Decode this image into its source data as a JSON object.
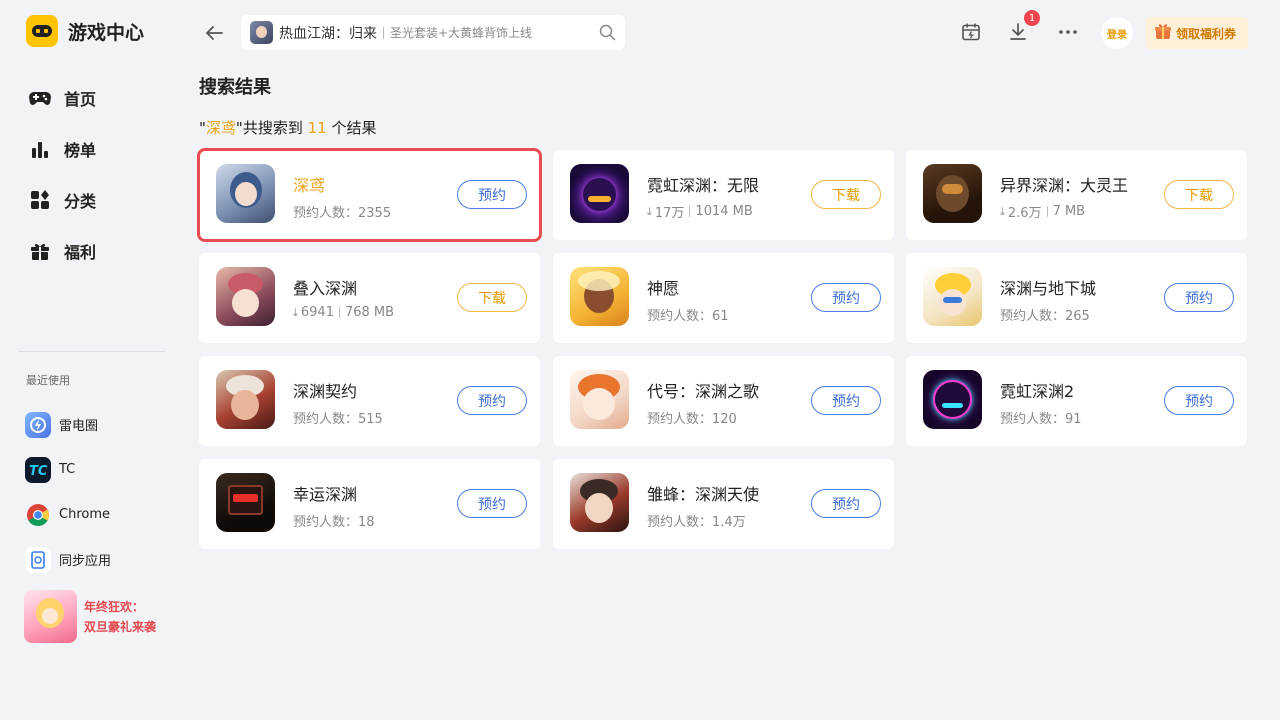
{
  "app": {
    "title": "游戏中心"
  },
  "sidebar": {
    "nav": [
      {
        "label": "首页",
        "icon": "gamepad-icon"
      },
      {
        "label": "榜单",
        "icon": "ranking-icon"
      },
      {
        "label": "分类",
        "icon": "category-icon"
      },
      {
        "label": "福利",
        "icon": "gift-icon"
      }
    ],
    "recent_title": "最近使用",
    "recent": [
      {
        "label": "雷电圈",
        "icon": "leidian-icon"
      },
      {
        "label": "TC",
        "icon": "tc-icon"
      },
      {
        "label": "Chrome",
        "icon": "chrome-icon"
      },
      {
        "label": "同步应用",
        "icon": "sync-app-icon"
      }
    ],
    "promo": {
      "line1": "年终狂欢：",
      "line2": "双旦豪礼来袭"
    }
  },
  "topbar": {
    "search_main": "热血江湖：归来",
    "search_sub": "圣光套装+大黄蜂背饰上线",
    "download_badge": "1",
    "login_label": "登录",
    "coupon_label": "领取福利券"
  },
  "content": {
    "title": "搜索结果",
    "summary": {
      "quote_open": "\"",
      "keyword": "深鸢",
      "text1": "\"共搜索到 ",
      "count": "11",
      "text2": " 个结果"
    }
  },
  "results": [
    {
      "name": "深鸢",
      "meta": "预约人数：2355",
      "button": "预约"
    },
    {
      "name": "霓虹深渊：无限",
      "downloads": "17万",
      "size": "1014 MB",
      "button": "下载"
    },
    {
      "name": "异界深渊：大灵王",
      "downloads": "2.6万",
      "size": "7 MB",
      "button": "下载"
    },
    {
      "name": "叠入深渊",
      "downloads": "6941",
      "size": "768 MB",
      "button": "下载"
    },
    {
      "name": "神愿",
      "meta": "预约人数：61",
      "button": "预约"
    },
    {
      "name": "深渊与地下城",
      "meta": "预约人数：265",
      "button": "预约"
    },
    {
      "name": "深渊契约",
      "meta": "预约人数：515",
      "button": "预约"
    },
    {
      "name": "代号：深渊之歌",
      "meta": "预约人数：120",
      "button": "预约"
    },
    {
      "name": "霓虹深渊2",
      "meta": "预约人数：91",
      "button": "预约"
    },
    {
      "name": "幸运深渊",
      "meta": "预约人数：18",
      "button": "预约"
    },
    {
      "name": "雏蜂：深渊天使",
      "meta": "预约人数：1.4万",
      "button": "预约"
    }
  ],
  "colors": {
    "accent": "#e8a317",
    "reserve": "#3c6fd9",
    "download": "#e39a00",
    "selection": "#ea4c53"
  }
}
